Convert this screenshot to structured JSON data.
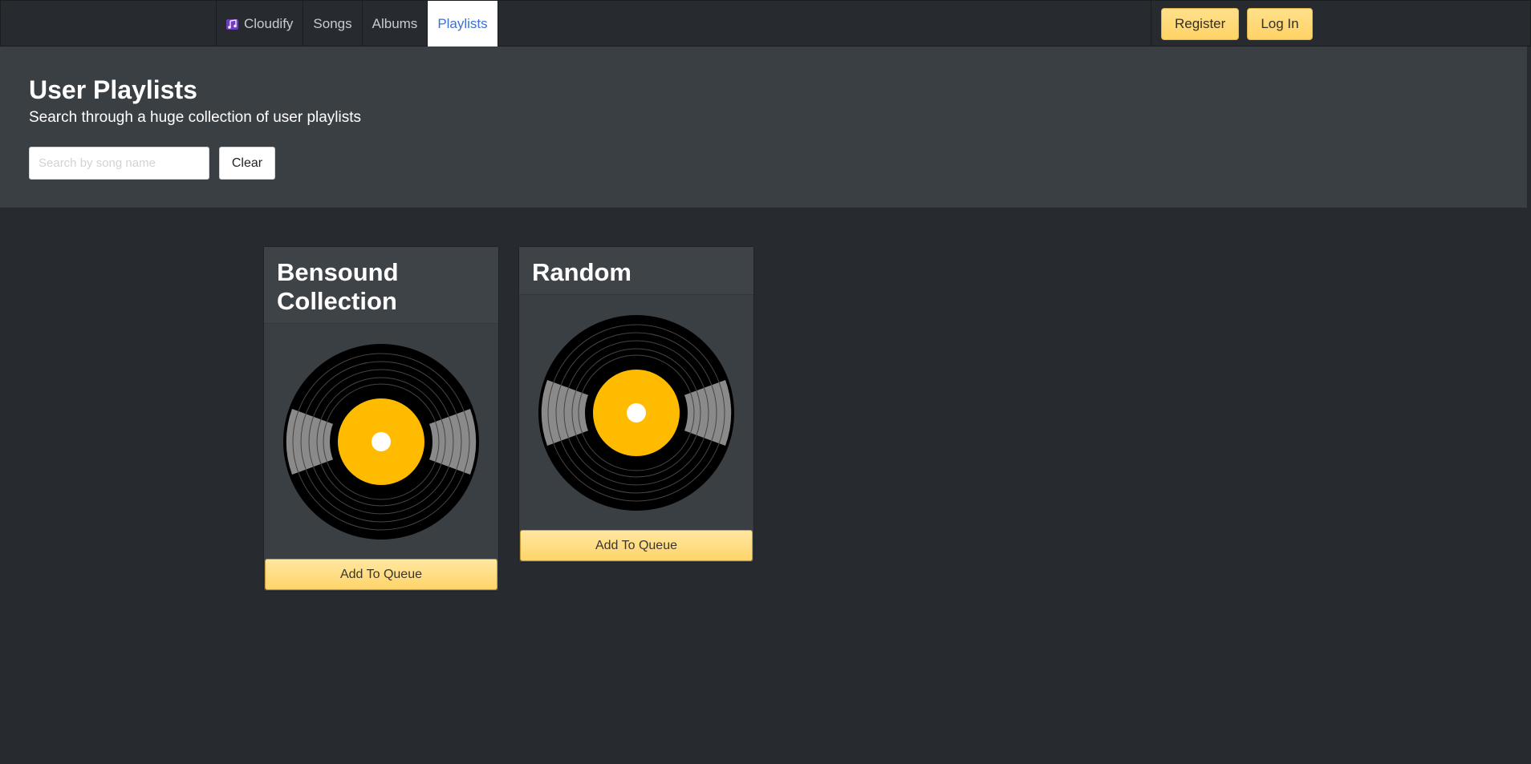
{
  "nav": {
    "brand": "Cloudify",
    "brand_icon": "music-notes-icon",
    "links": [
      {
        "label": "Songs",
        "active": false
      },
      {
        "label": "Albums",
        "active": false
      },
      {
        "label": "Playlists",
        "active": true
      }
    ],
    "register_label": "Register",
    "login_label": "Log In"
  },
  "hero": {
    "title": "User Playlists",
    "subtitle": "Search through a huge collection of user playlists",
    "search_placeholder": "Search by song name",
    "search_value": "",
    "clear_label": "Clear"
  },
  "playlists": [
    {
      "title": "Bensound Collection",
      "icon": "vinyl-record-icon",
      "button_label": "Add To Queue"
    },
    {
      "title": "Random",
      "icon": "vinyl-record-icon",
      "button_label": "Add To Queue"
    }
  ],
  "colors": {
    "background": "#272b30",
    "hero": "#3a3f44",
    "accent_yellow": "#ffd366",
    "record_label": "#ffbb00",
    "active_link": "#3d6fd6"
  }
}
